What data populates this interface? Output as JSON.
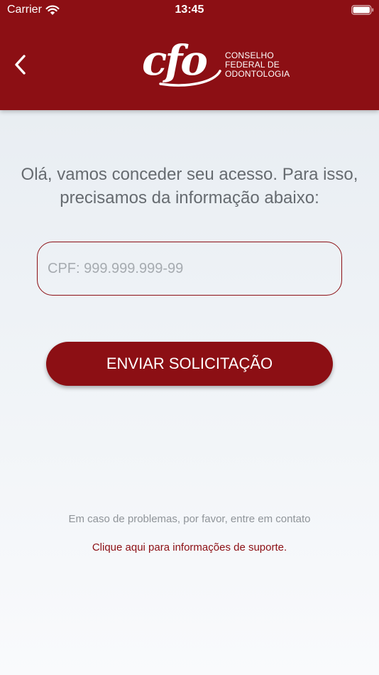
{
  "status_bar": {
    "carrier": "Carrier",
    "time": "13:45"
  },
  "header": {
    "logo_mark": "cfo",
    "logo_lines": [
      "CONSELHO",
      "FEDERAL DE",
      "ODONTOLOGIA"
    ]
  },
  "main": {
    "heading": "Olá, vamos conceder seu acesso. Para isso, precisamos da informação abaixo:",
    "cpf_placeholder": "CPF: 999.999.999-99",
    "cpf_value": "",
    "submit_label": "ENVIAR SOLICITAÇÃO"
  },
  "footer": {
    "help_text": "Em caso de problemas, por favor, entre em contato",
    "support_link": "Clique aqui para informações de suporte."
  },
  "icons": {
    "wifi": "wifi-icon",
    "battery": "battery-icon",
    "back": "chevron-left-icon"
  },
  "colors": {
    "brand": "#8c0f14",
    "heading_text": "#666b70",
    "muted_text": "#8f9499"
  }
}
